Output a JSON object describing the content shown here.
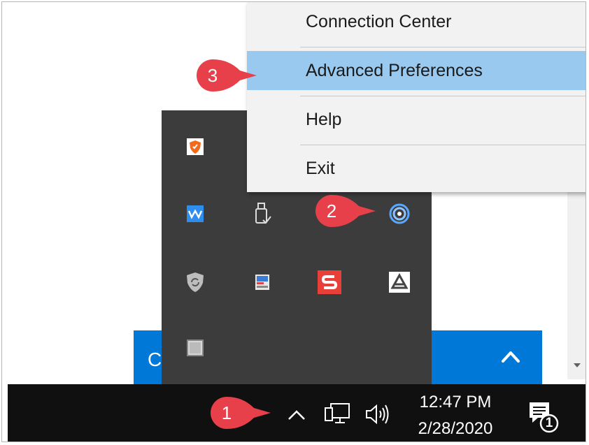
{
  "context_menu": {
    "items": [
      {
        "label": "Connection Center"
      },
      {
        "label": "Advanced Preferences"
      },
      {
        "label": "Help"
      },
      {
        "label": "Exit"
      }
    ]
  },
  "banner": {
    "partial_text": "C"
  },
  "taskbar": {
    "time": "12:47 PM",
    "date": "2/28/2020",
    "notification_count": "1"
  },
  "steps": [
    {
      "number": "1"
    },
    {
      "number": "2"
    },
    {
      "number": "3"
    }
  ],
  "colors": {
    "highlight": "#99c9ef",
    "banner_blue": "#0078d7",
    "badge_red": "#e8404a",
    "taskbar": "#101010",
    "flyout": "#3c3c3c"
  },
  "tray_icons": [
    "avast-shield-icon",
    "waves-audio-icon",
    "usb-safely-remove-icon",
    "citrix-workspace-icon",
    "security-shield-icon",
    "scanner-app-icon",
    "snagit-icon",
    "google-drive-icon",
    "generic-app-icon"
  ]
}
